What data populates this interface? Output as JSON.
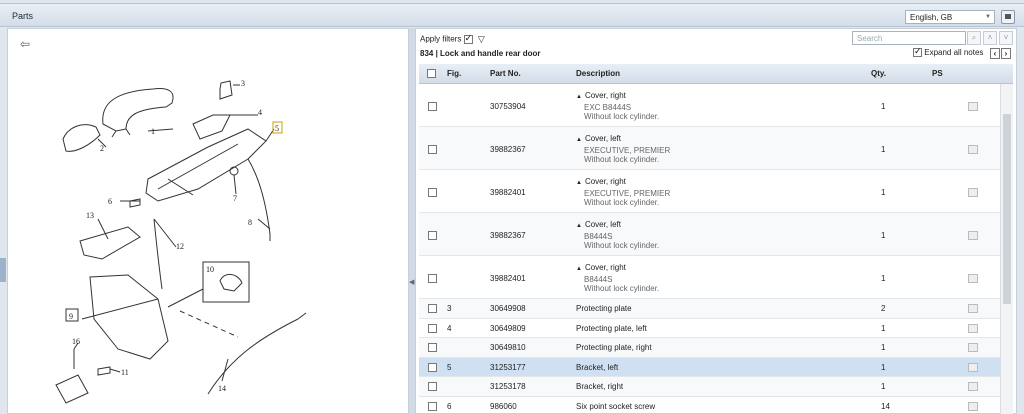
{
  "header": {
    "title": "Parts",
    "language": "English, GB"
  },
  "filters": {
    "apply_label": "Apply filters",
    "apply_checked": true
  },
  "breadcrumb": "834  |  Lock and handle rear door",
  "search": {
    "placeholder": "Search"
  },
  "expand": {
    "label": "Expand all notes",
    "checked": true
  },
  "table": {
    "columns": {
      "fig": "Fig.",
      "partno": "Part No.",
      "description": "Description",
      "qty": "Qty.",
      "ps": "PS"
    },
    "rows": [
      {
        "fig": "",
        "partno": "30753904",
        "desc": "Cover, right",
        "note1": "EXC B8444S",
        "note2": "Without lock cylinder.",
        "qty": "1"
      },
      {
        "fig": "",
        "partno": "39882367",
        "desc": "Cover, left",
        "note1": "EXECUTIVE, PREMIER",
        "note2": "Without lock cylinder.",
        "qty": "1"
      },
      {
        "fig": "",
        "partno": "39882401",
        "desc": "Cover, right",
        "note1": "EXECUTIVE, PREMIER",
        "note2": "Without lock cylinder.",
        "qty": "1"
      },
      {
        "fig": "",
        "partno": "39882367",
        "desc": "Cover, left",
        "note1": "B8444S",
        "note2": "Without lock cylinder.",
        "qty": "1"
      },
      {
        "fig": "",
        "partno": "39882401",
        "desc": "Cover, right",
        "note1": "B8444S",
        "note2": "Without lock cylinder.",
        "qty": "1"
      },
      {
        "fig": "3",
        "partno": "30649908",
        "desc": "Protecting plate",
        "qty": "2"
      },
      {
        "fig": "4",
        "partno": "30649809",
        "desc": "Protecting plate, left",
        "qty": "1"
      },
      {
        "fig": "",
        "partno": "30649810",
        "desc": "Protecting plate, right",
        "qty": "1"
      },
      {
        "fig": "5",
        "partno": "31253177",
        "desc": "Bracket, left",
        "qty": "1"
      },
      {
        "fig": "",
        "partno": "31253178",
        "desc": "Bracket, right",
        "qty": "1"
      },
      {
        "fig": "6",
        "partno": "986060",
        "desc": "Six point socket screw",
        "qty": "14"
      }
    ]
  },
  "diagram": {
    "callouts": [
      "1",
      "2",
      "3",
      "4",
      "5",
      "6",
      "7",
      "8",
      "9",
      "10",
      "11",
      "12",
      "13",
      "14",
      "16"
    ]
  }
}
